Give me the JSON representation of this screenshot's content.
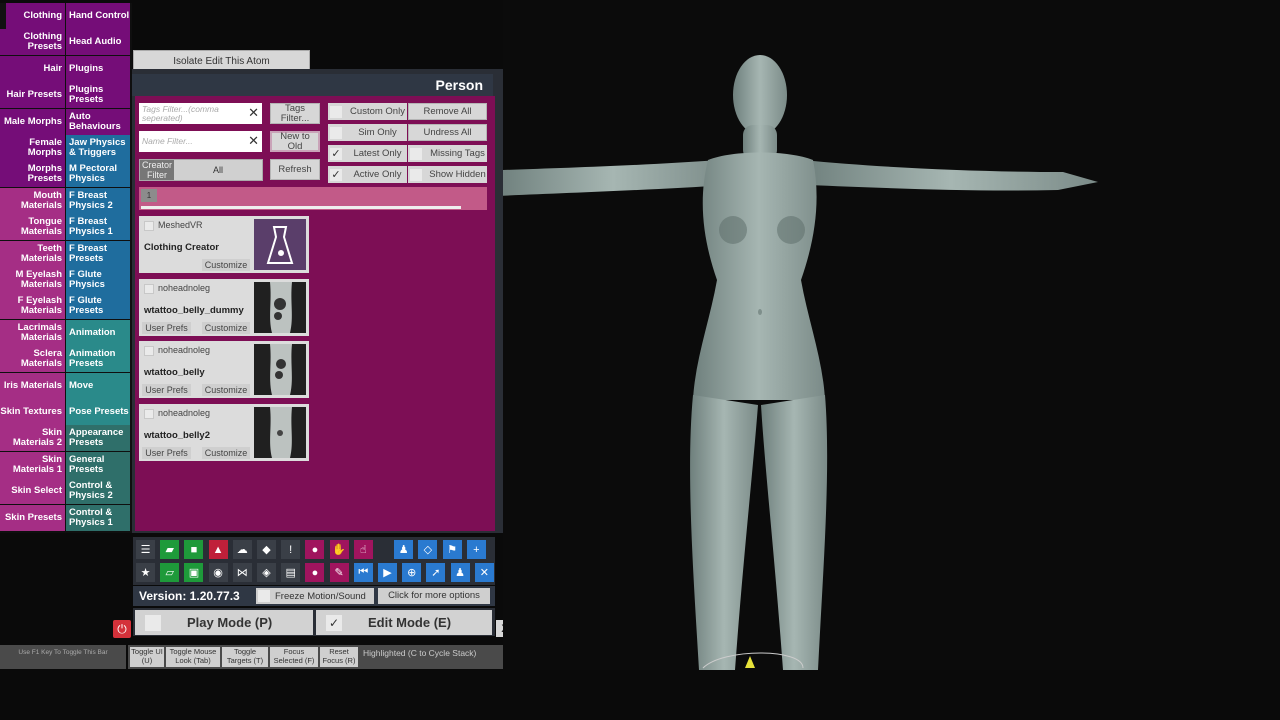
{
  "left_tabs": [
    {
      "left": "Clothing",
      "right": "Hand Control",
      "lc": "#750d78",
      "rc": "#750d78",
      "selected": true
    },
    {
      "left": "Clothing Presets",
      "right": "Head Audio",
      "lc": "#750d78",
      "rc": "#750d78"
    },
    {
      "left": "Hair",
      "right": "Plugins",
      "lc": "#750d78",
      "rc": "#750d78"
    },
    {
      "left": "Hair Presets",
      "right": "Plugins Presets",
      "lc": "#750d78",
      "rc": "#750d78"
    },
    {
      "left": "Male Morphs",
      "right": "Auto Behaviours",
      "lc": "#750d78",
      "rc": "#750d78"
    },
    {
      "left": "Female Morphs",
      "right": "Jaw Physics & Triggers",
      "lc": "#750d78",
      "rc": "#1f6d9e"
    },
    {
      "left": "Morphs Presets",
      "right": "M Pectoral Physics",
      "lc": "#750d78",
      "rc": "#1f6d9e"
    },
    {
      "left": "Mouth Materials",
      "right": "F Breast Physics 2",
      "lc": "#a52e85",
      "rc": "#1f6d9e"
    },
    {
      "left": "Tongue Materials",
      "right": "F Breast Physics 1",
      "lc": "#a52e85",
      "rc": "#1f6d9e"
    },
    {
      "left": "Teeth Materials",
      "right": "F Breast Presets",
      "lc": "#a52e85",
      "rc": "#1f6d9e"
    },
    {
      "left": "M Eyelash Materials",
      "right": "F Glute Physics",
      "lc": "#a52e85",
      "rc": "#1f6d9e"
    },
    {
      "left": "F Eyelash Materials",
      "right": "F Glute Presets",
      "lc": "#a52e85",
      "rc": "#1f6d9e"
    },
    {
      "left": "Lacrimals Materials",
      "right": "Animation",
      "lc": "#a52e85",
      "rc": "#2a8a8a"
    },
    {
      "left": "Sclera Materials",
      "right": "Animation Presets",
      "lc": "#a52e85",
      "rc": "#2a8a8a"
    },
    {
      "left": "Iris Materials",
      "right": "Move",
      "lc": "#a52e85",
      "rc": "#2a8a8a"
    },
    {
      "left": "Skin Textures",
      "right": "Pose Presets",
      "lc": "#a52e85",
      "rc": "#2a8a8a"
    },
    {
      "left": "Skin Materials 2",
      "right": "Appearance Presets",
      "lc": "#a52e85",
      "rc": "#2f6f6a"
    },
    {
      "left": "Skin Materials 1",
      "right": "General Presets",
      "lc": "#a52e85",
      "rc": "#2f6f6a"
    },
    {
      "left": "Skin Select",
      "right": "Control & Physics 2",
      "lc": "#a52e85",
      "rc": "#2f6f6a"
    },
    {
      "left": "Skin Presets",
      "right": "Control & Physics 1",
      "lc": "#a52e85",
      "rc": "#2f6f6a"
    }
  ],
  "isolate_label": "Isolate Edit This Atom",
  "panel": {
    "title": "Person",
    "tags_placeholder": "Tags Filter...(comma seperated)",
    "name_placeholder": "Name Filter...",
    "tags_filter_btn": "Tags Filter...",
    "sort_btn": "New to Old",
    "refresh_btn": "Refresh",
    "creator_label": "Creator Filter",
    "creator_value": "All",
    "checks": [
      {
        "label": "Custom Only",
        "checked": false
      },
      {
        "label": "Sim Only",
        "checked": false
      },
      {
        "label": "Latest Only",
        "checked": true
      },
      {
        "label": "Active Only",
        "checked": true
      }
    ],
    "right_buttons": [
      "Remove All",
      "Undress All"
    ],
    "right_checks": [
      {
        "label": "Missing Tags",
        "checked": false
      },
      {
        "label": "Show Hidden",
        "checked": false
      }
    ],
    "page": "1",
    "items": [
      {
        "creator": "MeshedVR",
        "name": "Clothing Creator",
        "user_prefs": "",
        "customize": "Customize"
      },
      {
        "creator": "noheadnoleg",
        "name": "wtattoo_belly_dummy",
        "user_prefs": "User Prefs",
        "customize": "Customize"
      },
      {
        "creator": "noheadnoleg",
        "name": "wtattoo_belly",
        "user_prefs": "User Prefs",
        "customize": "Customize"
      },
      {
        "creator": "noheadnoleg",
        "name": "wtattoo_belly2",
        "user_prefs": "User Prefs",
        "customize": "Customize"
      }
    ]
  },
  "toolbar": {
    "row1": [
      {
        "icon": "menu-icon",
        "bg": "#3a3f47",
        "glyph": "☰"
      },
      {
        "icon": "save-scene-icon",
        "bg": "#1e9a3a",
        "glyph": "▰"
      },
      {
        "icon": "open-folder-icon",
        "bg": "#1e9a3a",
        "glyph": "■"
      },
      {
        "icon": "load-look-icon",
        "bg": "#c0203a",
        "glyph": "▲"
      },
      {
        "icon": "cloud-icon",
        "bg": "#3a3f47",
        "glyph": "☁"
      },
      {
        "icon": "package-icon",
        "bg": "#3a3f47",
        "glyph": "◆"
      },
      {
        "icon": "alert-icon",
        "bg": "#3a3f47",
        "glyph": "!"
      },
      {
        "icon": "person-select-icon",
        "bg": "#a0145e",
        "glyph": "●"
      },
      {
        "icon": "hand-icon",
        "bg": "#a0145e",
        "glyph": "✋"
      },
      {
        "icon": "pointer-hand-icon",
        "bg": "#a0145e",
        "glyph": "☝"
      },
      {
        "icon": "person-icon",
        "bg": "#2a7ad0",
        "glyph": "♟"
      },
      {
        "icon": "unity-icon",
        "bg": "#2a7ad0",
        "glyph": "◇"
      },
      {
        "icon": "flag-icon",
        "bg": "#2a7ad0",
        "glyph": "⚑"
      },
      {
        "icon": "plus-icon",
        "bg": "#2a7ad0",
        "glyph": "+"
      }
    ],
    "row2": [
      {
        "icon": "star-icon",
        "bg": "#3a3f47",
        "glyph": "★"
      },
      {
        "icon": "save-as-icon",
        "bg": "#1e9a3a",
        "glyph": "▱"
      },
      {
        "icon": "camera-folder-icon",
        "bg": "#1e9a3a",
        "glyph": "▣"
      },
      {
        "icon": "camera-icon",
        "bg": "#3a3f47",
        "glyph": "◉"
      },
      {
        "icon": "share-icon",
        "bg": "#3a3f47",
        "glyph": "⋈"
      },
      {
        "icon": "cube-icon",
        "bg": "#3a3f47",
        "glyph": "◈"
      },
      {
        "icon": "document-icon",
        "bg": "#3a3f47",
        "glyph": "▤"
      },
      {
        "icon": "person-edit-icon",
        "bg": "#a0145e",
        "glyph": "●"
      },
      {
        "icon": "wrench-icon",
        "bg": "#a0145e",
        "glyph": "✎"
      },
      {
        "icon": "rewind-icon",
        "bg": "#2a7ad0",
        "glyph": "⏮"
      },
      {
        "icon": "play-icon",
        "bg": "#2a7ad0",
        "glyph": "▶"
      },
      {
        "icon": "target-icon",
        "bg": "#2a7ad0",
        "glyph": "⊕"
      },
      {
        "icon": "select-arrow-icon",
        "bg": "#2a7ad0",
        "glyph": "➚"
      },
      {
        "icon": "group-icon",
        "bg": "#2a7ad0",
        "glyph": "♟"
      },
      {
        "icon": "tools-icon",
        "bg": "#2a7ad0",
        "glyph": "✕"
      }
    ]
  },
  "version": "Version: 1.20.77.3",
  "freeze_label": "Freeze Motion/Sound",
  "more_options": "Click for more options",
  "play_mode": "Play Mode (P)",
  "edit_mode": "Edit Mode (E)",
  "close_label": "X",
  "f1_hint": "Use F1 Key To Toggle This Bar",
  "bottom_buttons": [
    "Toggle UI (U)",
    "Toggle Mouse Look (Tab)",
    "Toggle Targets (T)",
    "Focus Selected (F)",
    "Reset Focus (R)"
  ],
  "highlighted": "Highlighted (C to Cycle Stack)",
  "figure_color": "#a6b6b2"
}
